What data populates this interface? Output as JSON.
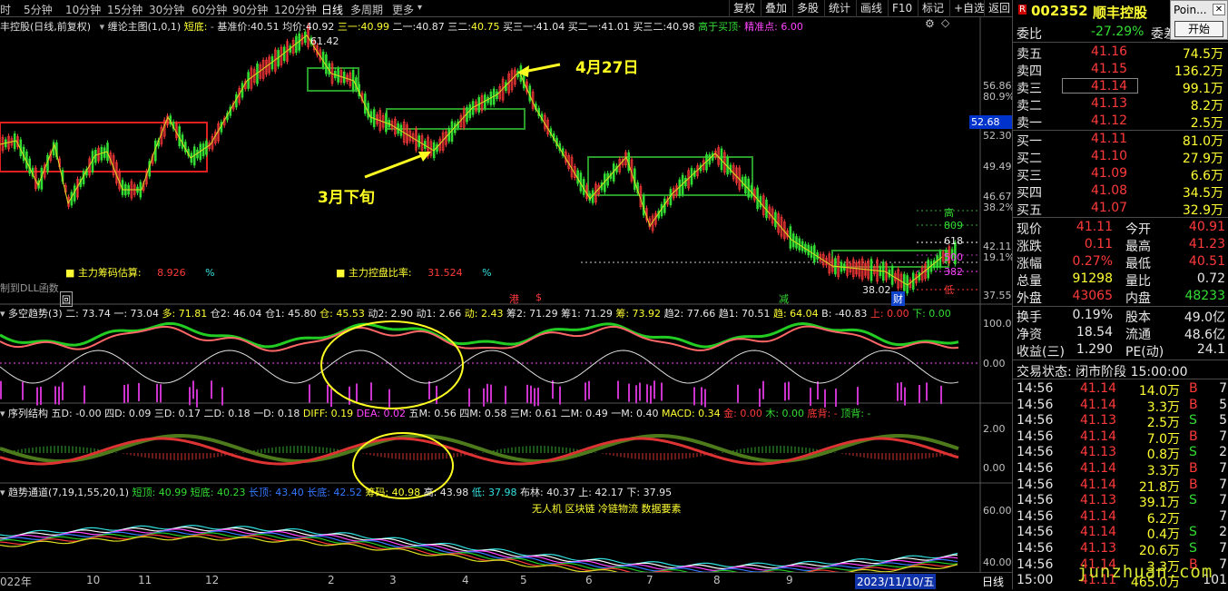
{
  "toolbar": {
    "tabs": [
      "时",
      "5分钟",
      "10分钟",
      "15分钟",
      "30分钟",
      "60分钟",
      "90分钟",
      "120分钟",
      "日线",
      "多周期",
      "更多"
    ],
    "buttons": [
      "复权",
      "叠加",
      "多股",
      "统计",
      "画线",
      "F10",
      "标记",
      "+自选",
      "返回"
    ]
  },
  "main_panel": {
    "title": "丰控股(日线,前复权)",
    "indicator_name": "缠论主图(1,0,1)",
    "short_bottom_label": "短底:",
    "items": [
      {
        "label": "基准价:",
        "value": "40.51"
      },
      {
        "label": "均价:",
        "value": "40.92"
      },
      {
        "label": "三一:",
        "value": "40.99"
      },
      {
        "label": "二一:",
        "value": "40.87"
      },
      {
        "label": "三二:",
        "value": "40.75"
      },
      {
        "label": "买三一:",
        "value": "41.04"
      },
      {
        "label": "买二一:",
        "value": "41.01"
      },
      {
        "label": "买三二:",
        "value": "40.98"
      }
    ],
    "above_buy": "高于买顶·",
    "precise_point": "精准点: 6.00",
    "max_price": "61.42",
    "min_price": "38.02",
    "chip_estimate_label": "主力筹码估算:",
    "chip_estimate_value": "8.926",
    "control_ratio_label": "主力控盘比率:",
    "control_ratio_value": "31.524",
    "percent_sign": "%",
    "dll_text": "制到DLL函数",
    "box_hui": "回",
    "box_gang": "港",
    "box_jian": "减",
    "box_cai": "财",
    "right_labels": [
      "高",
      "809",
      "618",
      "500",
      "382",
      "191",
      "低"
    ],
    "annotation_april": "4月27日",
    "annotation_march": "3月下旬"
  },
  "price_axis": [
    "56.86",
    "80.9%",
    "52.30",
    "49.49",
    "46.67",
    "38.2%",
    "42.11",
    "19.1%",
    "37.55"
  ],
  "current_price_tag": "52.68",
  "panel2": {
    "title": "多空趋势(3)",
    "items": [
      "二: 73.74",
      "一: 73.04",
      "多: 71.81",
      "仓2: 46.04",
      "仓1: 45.80",
      "仓: 45.53",
      "动2: 2.90",
      "动1: 2.66",
      "动: 2.43",
      "筹2: 71.29",
      "筹1: 71.29",
      "筹: 73.92",
      "趋2: 77.66",
      "趋1: 70.51",
      "趋: 64.04",
      "B: -40.83",
      "上: 0.00",
      "下: 0.00"
    ],
    "axis": [
      "100.0",
      "0.00"
    ]
  },
  "panel3": {
    "title": "序列结构",
    "items": [
      "五D: -0.00",
      "四D: 0.09",
      "三D: 0.17",
      "二D: 0.18",
      "一D: 0.18",
      "DIFF: 0.19",
      "DEA: 0.02",
      "五M: 0.56",
      "四M: 0.58",
      "三M: 0.61",
      "二M: 0.49",
      "一M: 0.40",
      "MACD: 0.34",
      "金: 0.00",
      "木: 0.00",
      "底背: -",
      "顶背: -"
    ],
    "axis": [
      "2.00",
      "0.00"
    ]
  },
  "panel4": {
    "title": "趋势通道(7,19,1,55,20,1)",
    "items": [
      "短顶: 40.99",
      "短底: 40.23",
      "长顶: 43.40",
      "长底: 42.52",
      "筹码: 40.98",
      "高: 43.98",
      "低: 37.98",
      "布林: 40.37",
      "上: 42.17",
      "下: 37.95"
    ],
    "news": "无人机 区块链 冷链物流 数据要素",
    "axis": [
      "60.00",
      "40.00"
    ]
  },
  "time_axis": {
    "labels": [
      "022年",
      "10",
      "11",
      "12",
      "2",
      "3",
      "4",
      "5",
      "6",
      "7",
      "8",
      "9"
    ],
    "date_tag": "2023/11/10/五",
    "period": "日线"
  },
  "sidepanel": {
    "code": "002352",
    "name": "顺丰控股",
    "webi_label": "委比",
    "webi_value": "-27.29%",
    "weicha_label": "委差",
    "sell_orders": [
      {
        "label": "卖五",
        "price": "41.16",
        "vol": "74.5万"
      },
      {
        "label": "卖四",
        "price": "41.15",
        "vol": "136.2万"
      },
      {
        "label": "卖三",
        "price": "41.14",
        "vol": "99.1万"
      },
      {
        "label": "卖二",
        "price": "41.13",
        "vol": "8.2万"
      },
      {
        "label": "卖一",
        "price": "41.12",
        "vol": "2.5万"
      }
    ],
    "buy_orders": [
      {
        "label": "买一",
        "price": "41.11",
        "vol": "81.0万"
      },
      {
        "label": "买二",
        "price": "41.10",
        "vol": "27.9万"
      },
      {
        "label": "买三",
        "price": "41.09",
        "vol": "6.6万"
      },
      {
        "label": "买四",
        "price": "41.08",
        "vol": "34.5万"
      },
      {
        "label": "买五",
        "price": "41.07",
        "vol": "32.9万"
      }
    ],
    "stats": [
      {
        "l1": "现价",
        "v1": "41.11",
        "l2": "今开",
        "v2": "40.91",
        "c1": "red",
        "c2": "red"
      },
      {
        "l1": "涨跌",
        "v1": "0.11",
        "l2": "最高",
        "v2": "41.23",
        "c1": "red",
        "c2": "red"
      },
      {
        "l1": "涨幅",
        "v1": "0.27%",
        "l2": "最低",
        "v2": "40.51",
        "c1": "red",
        "c2": "red"
      },
      {
        "l1": "总量",
        "v1": "91298",
        "l2": "量比",
        "v2": "0.72",
        "c1": "yellow",
        "c2": "white"
      },
      {
        "l1": "外盘",
        "v1": "43065",
        "l2": "内盘",
        "v2": "48233",
        "c1": "red",
        "c2": "green"
      }
    ],
    "stats2": [
      {
        "l1": "换手",
        "v1": "0.19%",
        "l2": "股本",
        "v2": "49.0亿"
      },
      {
        "l1": "净资",
        "v1": "18.54",
        "l2": "流通",
        "v2": "48.6亿"
      },
      {
        "l1": "收益(三)",
        "v1": "1.290",
        "l2": "PE(动)",
        "v2": "24.1"
      }
    ],
    "trade_status": "交易状态: 闭市阶段 15:00:00",
    "ticks": [
      {
        "t": "14:56",
        "p": "41.14",
        "v": "14.0万",
        "bs": "B",
        "n": "7"
      },
      {
        "t": "14:56",
        "p": "41.14",
        "v": "3.3万",
        "bs": "B",
        "n": "5"
      },
      {
        "t": "14:56",
        "p": "41.13",
        "v": "2.5万",
        "bs": "S",
        "n": "5"
      },
      {
        "t": "14:56",
        "p": "41.14",
        "v": "7.0万",
        "bs": "B",
        "n": "7"
      },
      {
        "t": "14:56",
        "p": "41.13",
        "v": "0.8万",
        "bs": "S",
        "n": "2"
      },
      {
        "t": "14:56",
        "p": "41.14",
        "v": "3.3万",
        "bs": "B",
        "n": "7"
      },
      {
        "t": "14:56",
        "p": "41.14",
        "v": "21.8万",
        "bs": "B",
        "n": "7"
      },
      {
        "t": "14:56",
        "p": "41.13",
        "v": "39.1万",
        "bs": "S",
        "n": "7"
      },
      {
        "t": "14:56",
        "p": "41.14",
        "v": "6.2万",
        "bs": "",
        "n": "7"
      },
      {
        "t": "14:56",
        "p": "41.14",
        "v": "0.4万",
        "bs": "S",
        "n": "2"
      },
      {
        "t": "14:56",
        "p": "41.13",
        "v": "20.6万",
        "bs": "S",
        "n": "7"
      },
      {
        "t": "14:56",
        "p": "41.14",
        "v": "3.3万",
        "bs": "B",
        "n": "7"
      },
      {
        "t": "15:00",
        "p": "41.11",
        "v": "465.0万",
        "bs": "",
        "n": "101"
      }
    ]
  },
  "popup": {
    "title": "Poin...",
    "button": "开始"
  },
  "watermark": "junzhuan.com",
  "colors": {
    "up": "#ff3a3a",
    "down": "#33dd33",
    "box_green": "#2a9a2a",
    "box_red": "#e02020",
    "annotation": "#ffff22",
    "price_line": "#dddd22"
  }
}
